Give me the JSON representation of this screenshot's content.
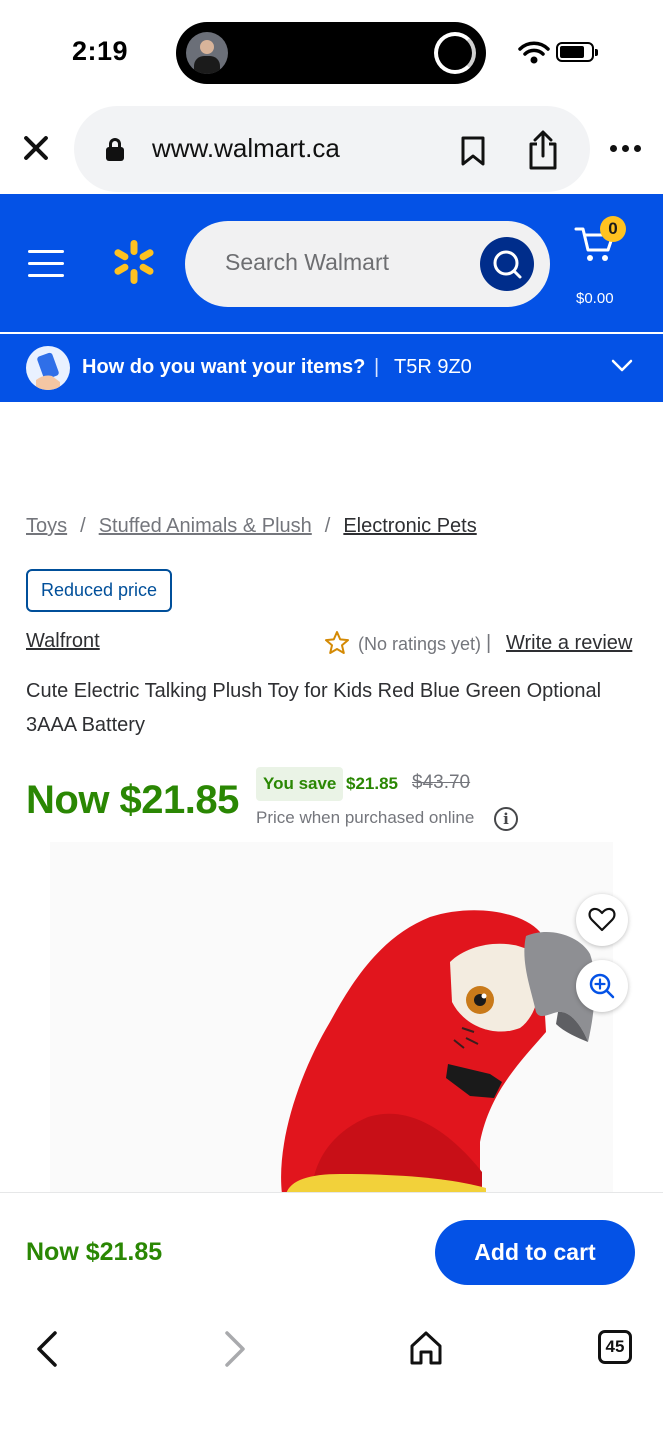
{
  "status_bar": {
    "time": "2:19"
  },
  "browser": {
    "url": "www.walmart.ca",
    "tab_count": "45"
  },
  "header": {
    "search_placeholder": "Search Walmart",
    "cart_count": "0",
    "cart_total": "$0.00",
    "brand_color": "#0452e6",
    "spark_color": "#ffc220"
  },
  "delivery": {
    "question": "How do you want your items?",
    "separator": "|",
    "postal_code": "T5R 9Z0"
  },
  "breadcrumb": {
    "items": [
      "Toys",
      "Stuffed Animals & Plush",
      "Electronic Pets"
    ],
    "separator": "/"
  },
  "product": {
    "badge": "Reduced price",
    "brand": "Walfront",
    "rating_text": "(No ratings yet)",
    "rating_separator": "|",
    "write_review": "Write a review",
    "title": "Cute Electric Talking Plush Toy for Kids Red Blue Green Optional 3AAA Battery",
    "now_price": "Now $21.85",
    "you_save_label": "You save",
    "save_amount": "$21.85",
    "was_price": "$43.70",
    "price_note": "Price when purchased online",
    "price_color": "#2a8703"
  },
  "sticky": {
    "price": "Now $21.85",
    "add_to_cart": "Add to cart"
  },
  "icons": {
    "info": "i"
  }
}
